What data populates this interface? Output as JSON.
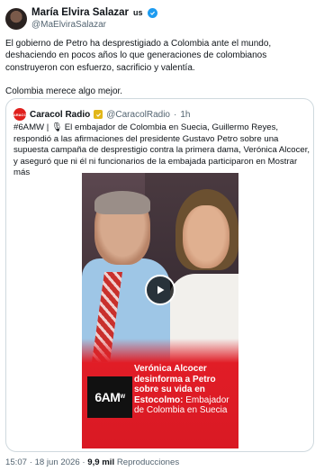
{
  "author": {
    "name": "María Elvira Salazar",
    "flag": "us",
    "handle": "@MaElviraSalazar",
    "verified_color": "#1d9bf0"
  },
  "tweet": {
    "paragraph1": "El gobierno de Petro ha desprestigiado a Colombia ante el mundo, deshaciendo en pocos años lo que generaciones de colombianos construyeron con esfuerzo, sacrificio y valentía.",
    "paragraph2": "Colombia merece algo mejor."
  },
  "quoted": {
    "name": "Caracol Radio",
    "handle": "@CaracolRadio",
    "time": "1h",
    "logo_text": "CARACOL",
    "text": "#6AMW | 🎙 El embajador de Colombia en Suecia, Guillermo Reyes, respondió a las afirmaciones del presidente Gustavo Petro sobre una supuesta campaña de desprestigio contra la primera dama, Verónica Alcocer, y aseguró que ni él ni funcionarios de la embajada participaron en Mostrar más",
    "video": {
      "caption_bold": "Verónica Alcocer desinforma a Petro sobre su vida en Estocolmo:",
      "caption_regular": "Embajador de Colombia en Suecia",
      "badge": "6AM",
      "badge_small": "W",
      "brand_color": "#e11d26"
    }
  },
  "footer": {
    "time": "15:07",
    "date": "18 jun 2026",
    "views_count": "9,9 mil",
    "views_label": "Reproducciones"
  }
}
